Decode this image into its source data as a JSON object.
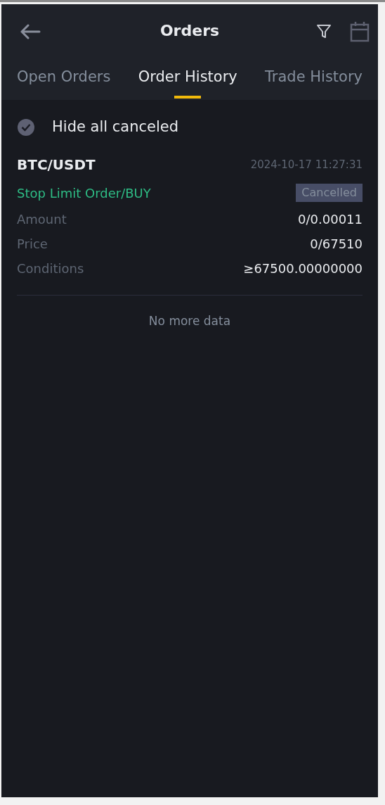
{
  "header": {
    "title": "Orders"
  },
  "tabs": [
    {
      "label": "Open Orders",
      "selected": false
    },
    {
      "label": "Order History",
      "selected": true
    },
    {
      "label": "Trade History",
      "selected": false
    }
  ],
  "filter": {
    "label": "Hide all canceled",
    "checked": true
  },
  "orders": [
    {
      "pair": "BTC/USDT",
      "time": "2024-10-17 11:27:31",
      "type": "Stop Limit Order/BUY",
      "color": "#2ebd85",
      "status": "Cancelled",
      "fields": [
        {
          "label": "Amount",
          "value": "0/0.00011"
        },
        {
          "label": "Price",
          "value": "0/67510"
        },
        {
          "label": "Conditions",
          "value": "≥67500.00000000"
        }
      ]
    }
  ],
  "footer": "No more data"
}
